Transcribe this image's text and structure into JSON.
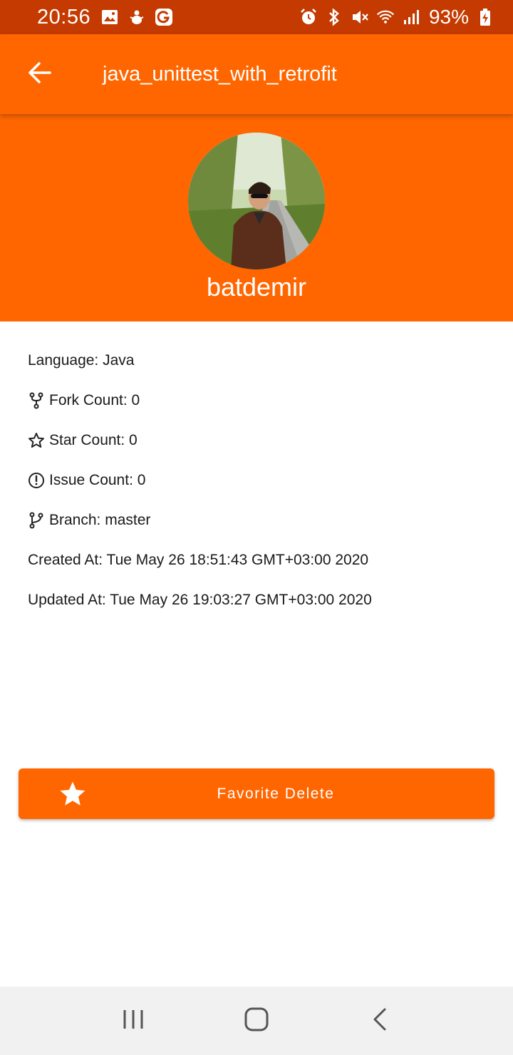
{
  "status_bar": {
    "time": "20:56",
    "battery": "93%",
    "icons": [
      "image-icon",
      "bug-icon",
      "g-app-icon",
      "alarm-icon",
      "bluetooth-icon",
      "mute-icon",
      "wifi-icon",
      "signal-icon",
      "battery-charging-icon"
    ]
  },
  "app_bar": {
    "title": "java_unittest_with_retrofit",
    "back_icon": "arrow-back-icon"
  },
  "profile": {
    "username": "batdemir"
  },
  "details": {
    "language": "Language: Java",
    "fork": "Fork Count: 0",
    "star": "Star Count: 0",
    "issue": "Issue Count: 0",
    "branch": "Branch: master",
    "created": "Created At: Tue May 26 18:51:43 GMT+03:00 2020",
    "updated": "Updated At: Tue May 26 19:03:27 GMT+03:00 2020"
  },
  "favorite_button": {
    "label": "Favorite Delete",
    "icon": "star-icon"
  },
  "colors": {
    "primary": "#ff6600",
    "status_bar": "#c43a00",
    "nav_bar": "#f1f1f1"
  }
}
